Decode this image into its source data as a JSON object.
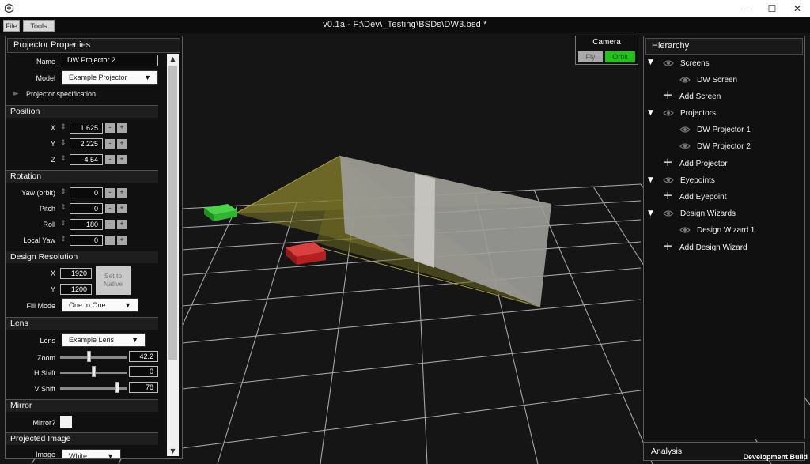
{
  "window": {
    "title_text": "v0.1a -  F:\\Dev\\_Testing\\BSDs\\DW3.bsd  *",
    "controls": {
      "minimize": "—",
      "maximize": "☐",
      "close": "✕"
    }
  },
  "menubar": {
    "items": [
      "File",
      "Tools"
    ]
  },
  "properties": {
    "header": "Projector Properties",
    "name_label": "Name",
    "name_value": "DW Projector 2",
    "model_label": "Model",
    "model_value": "Example Projector",
    "spec_label": "Projector specification",
    "position": {
      "title": "Position",
      "rows": [
        {
          "label": "X",
          "value": "1.625"
        },
        {
          "label": "Y",
          "value": "2.225"
        },
        {
          "label": "Z",
          "value": "-4.54"
        }
      ]
    },
    "rotation": {
      "title": "Rotation",
      "rows": [
        {
          "label": "Yaw (orbit)",
          "value": "0"
        },
        {
          "label": "Pitch",
          "value": "0"
        },
        {
          "label": "Roll",
          "value": "180"
        },
        {
          "label": "Local Yaw",
          "value": "0"
        }
      ]
    },
    "stepper_minus": "-",
    "stepper_plus": "+",
    "design_resolution": {
      "title": "Design Resolution",
      "x_label": "X",
      "x_value": "1920",
      "y_label": "Y",
      "y_value": "1200",
      "native_button": "Set to Native",
      "fill_label": "Fill Mode",
      "fill_value": "One to One"
    },
    "lens": {
      "title": "Lens",
      "lens_label": "Lens",
      "lens_value": "Example Lens",
      "zoom_label": "Zoom",
      "zoom_value": "42.2",
      "zoom_level": 0.5,
      "hshift_label": "H Shift",
      "hshift_value": "0",
      "hshift_level": 0.5,
      "vshift_label": "V Shift",
      "vshift_value": "78",
      "vshift_level": 0.88
    },
    "mirror": {
      "title": "Mirror",
      "label": "Mirror?"
    },
    "projected_image": {
      "title": "Projected Image",
      "image_label": "Image",
      "image_value": "White"
    }
  },
  "camera": {
    "title": "Camera",
    "fly": "Fly",
    "orbit": "Orbit",
    "active_color": "#22c41a"
  },
  "hierarchy": {
    "header": "Hierarchy",
    "items": [
      {
        "label": "Screens"
      },
      {
        "label": "DW Screen"
      },
      {
        "label": "Add Screen"
      },
      {
        "label": "Projectors"
      },
      {
        "label": "DW Projector 1"
      },
      {
        "label": "DW Projector 2"
      },
      {
        "label": "Add Projector"
      },
      {
        "label": "Eyepoints"
      },
      {
        "label": "Add Eyepoint"
      },
      {
        "label": "Design Wizards"
      },
      {
        "label": "Design Wizard 1"
      },
      {
        "label": "Add Design Wizard"
      }
    ]
  },
  "analysis": {
    "header": "Analysis"
  },
  "footer": {
    "build_label": "Development Build"
  },
  "scene": {
    "projector_1_color": "#2fb52f",
    "projector_2_color": "#b51f1f",
    "frustum_color": "#7a7424",
    "screen_color": "#9d9d9a"
  }
}
